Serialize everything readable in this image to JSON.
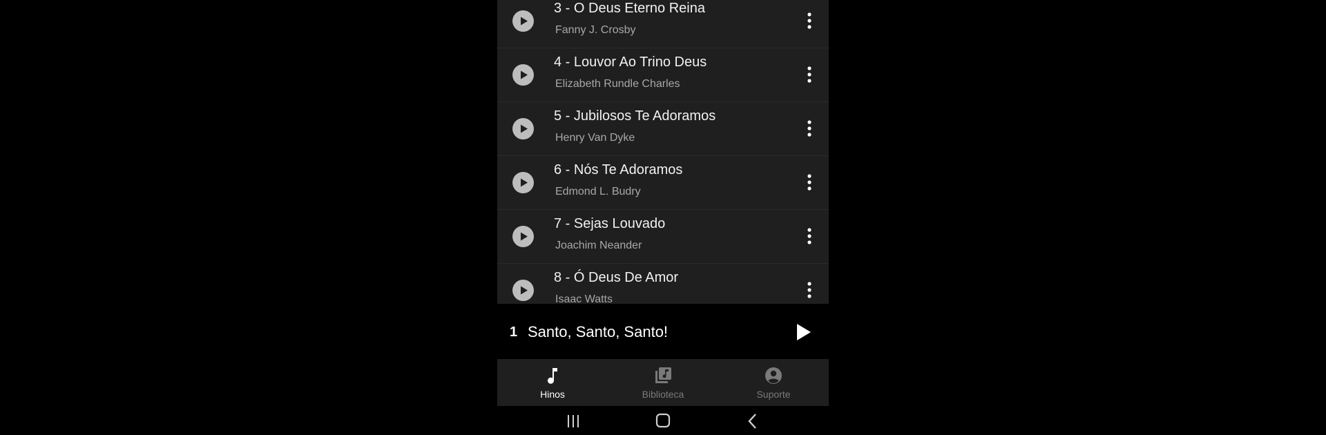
{
  "hymns": [
    {
      "title": "3 - O Deus Eterno Reina",
      "author": "Fanny J. Crosby"
    },
    {
      "title": "4 - Louvor Ao Trino Deus",
      "author": "Elizabeth Rundle Charles"
    },
    {
      "title": "5 - Jubilosos Te Adoramos",
      "author": "Henry Van Dyke"
    },
    {
      "title": "6 - Nós Te Adoramos",
      "author": "Edmond L. Budry"
    },
    {
      "title": "7 - Sejas Louvado",
      "author": "Joachim Neander"
    },
    {
      "title": "8 - Ó Deus De Amor",
      "author": "Isaac Watts"
    }
  ],
  "player": {
    "number": "1",
    "title": "Santo, Santo, Santo!",
    "play_icon": "play-icon"
  },
  "bottom_nav": {
    "items": [
      {
        "label": "Hinos",
        "icon": "music-note-icon",
        "active": true
      },
      {
        "label": "Biblioteca",
        "icon": "library-music-icon",
        "active": false
      },
      {
        "label": "Suporte",
        "icon": "account-circle-icon",
        "active": false
      }
    ]
  },
  "system_nav": {
    "recents_icon": "recents-icon",
    "home_icon": "home-icon",
    "back_icon": "back-icon"
  },
  "colors": {
    "background": "#000000",
    "list_background": "#1f1f1f",
    "active": "#ffffff",
    "inactive": "#7a7a7a",
    "play_button": "#bdbdbd"
  }
}
